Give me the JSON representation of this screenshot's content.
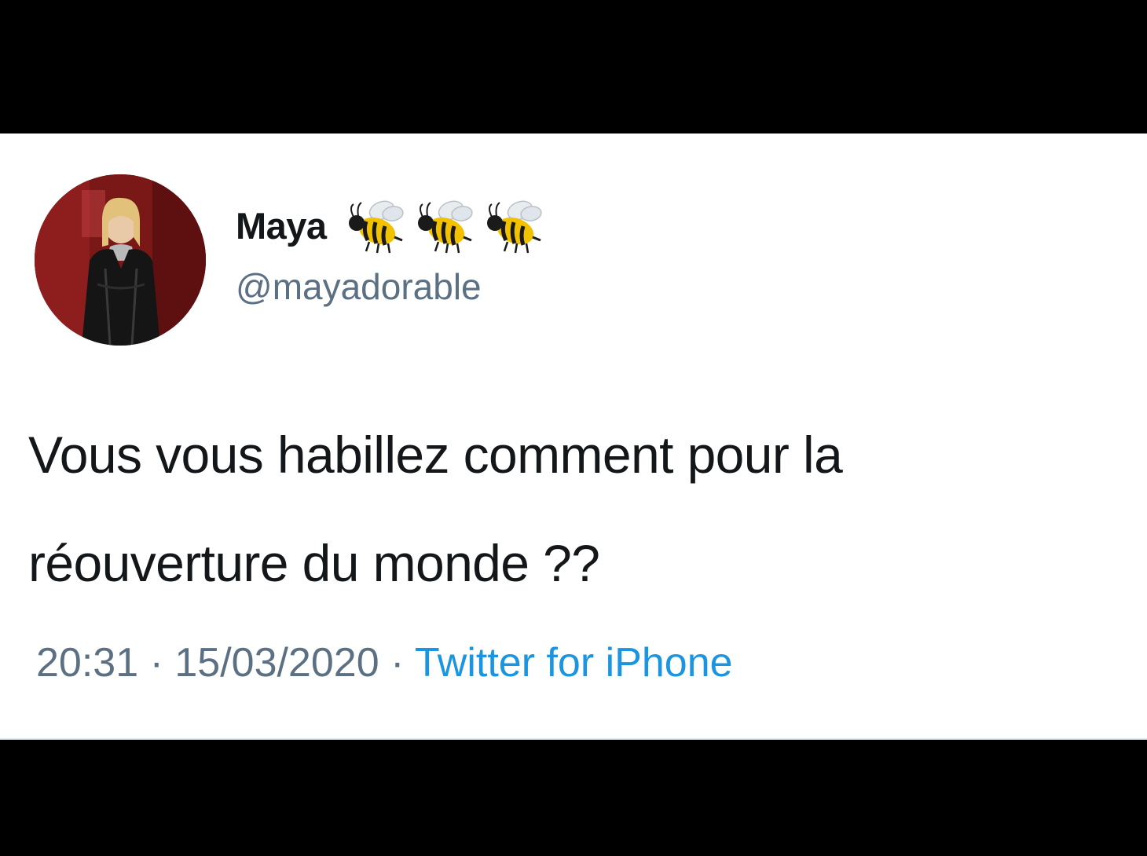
{
  "tweet": {
    "author": {
      "display_name": "Maya",
      "name_emojis": [
        "bee-icon",
        "bee-icon",
        "bee-icon"
      ],
      "handle": "@mayadorable",
      "avatar": "avatar-photo"
    },
    "text_lines": [
      "Vous vous habillez comment pour la",
      "réouverture du monde ??"
    ],
    "time": "20:31",
    "separator": "·",
    "date": "15/03/2020",
    "source": "Twitter for iPhone"
  },
  "colors": {
    "background": "#000000",
    "card": "#ffffff",
    "text": "#14171a",
    "secondary": "#5b7083",
    "link": "#1b95e0"
  }
}
